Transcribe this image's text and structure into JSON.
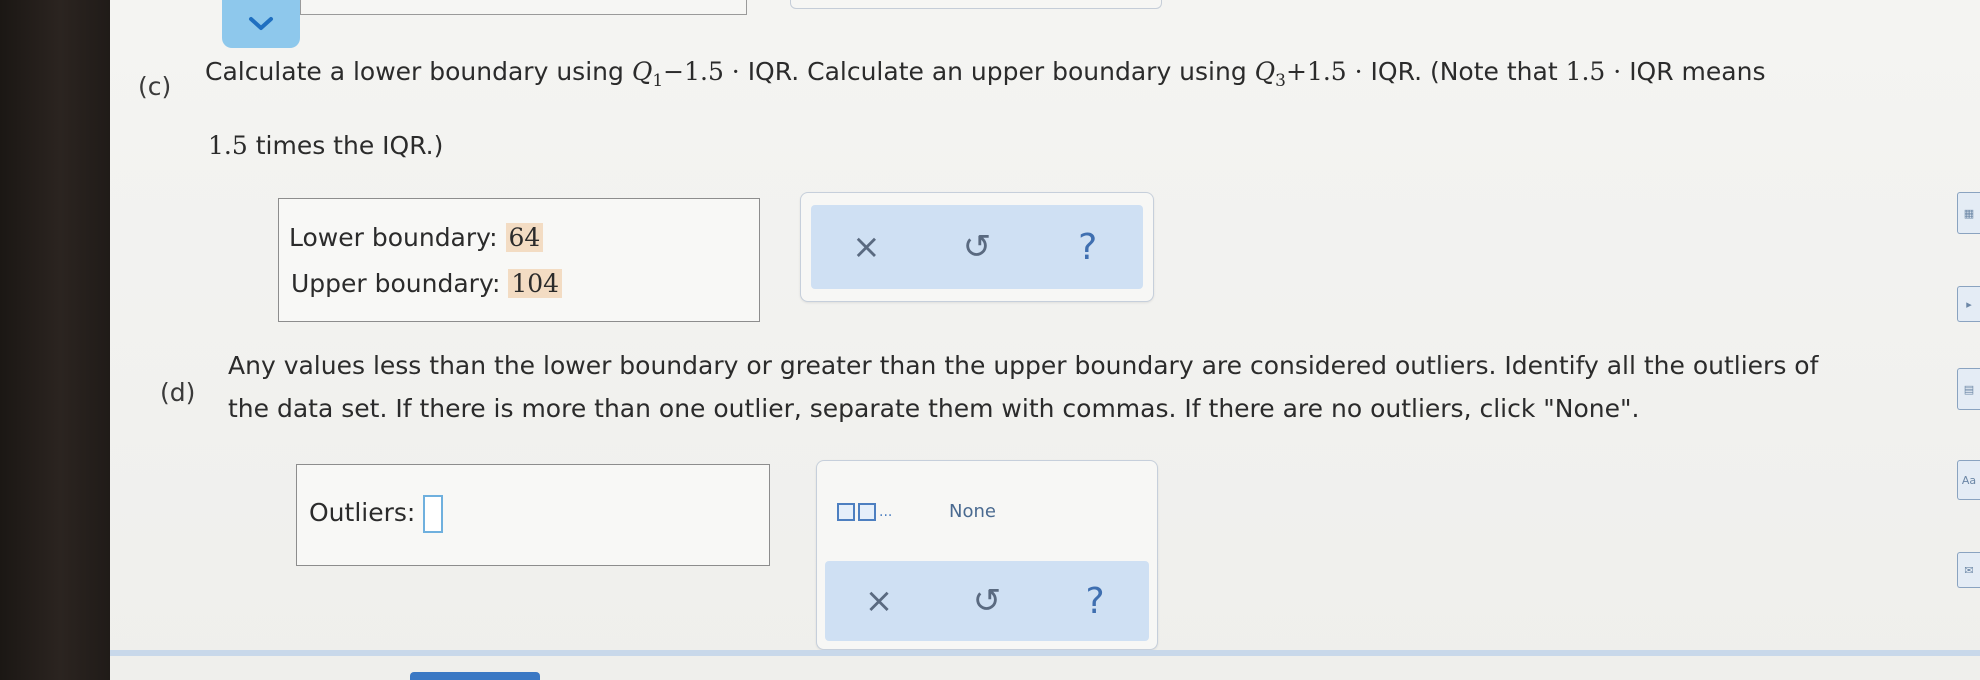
{
  "part_c": {
    "label": "(c)",
    "line1_a": "Calculate a lower boundary using ",
    "q1_var": "Q",
    "q1_sub": "1",
    "q1_rest": "−1.5 · ",
    "iqr1": "IQR",
    "line1_b": ". Calculate an upper boundary using ",
    "q3_var": "Q",
    "q3_sub": "3",
    "q3_rest": "+1.5 · ",
    "iqr2": "IQR",
    "line1_c": ". (Note that ",
    "note_math": "1.5 · ",
    "iqr3": "IQR",
    "line1_d": " means",
    "line2_math": "1.5",
    "line2_text": " times the IQR.)",
    "lower_label": "Lower boundary:",
    "lower_value": "64",
    "upper_label": "Upper boundary:",
    "upper_value": "104"
  },
  "part_d": {
    "label": "(d)",
    "line1": "Any values less than the lower boundary or greater than the upper boundary are considered outliers. Identify all the outliers of",
    "line2": "the data set. If there is more than one outlier, separate them with commas. If there are no outliers, click \"None\".",
    "outliers_label": "Outliers:",
    "outliers_value": "",
    "list_dots": "...",
    "none_label": "None"
  },
  "tools": {
    "clear": "×",
    "undo": "↺",
    "help": "?"
  },
  "icons": [
    "chevron-down-icon",
    "close-icon",
    "undo-icon",
    "help-icon",
    "list-template-icon",
    "calculator-icon",
    "book-icon",
    "table-icon",
    "text-size-icon",
    "mail-icon"
  ]
}
